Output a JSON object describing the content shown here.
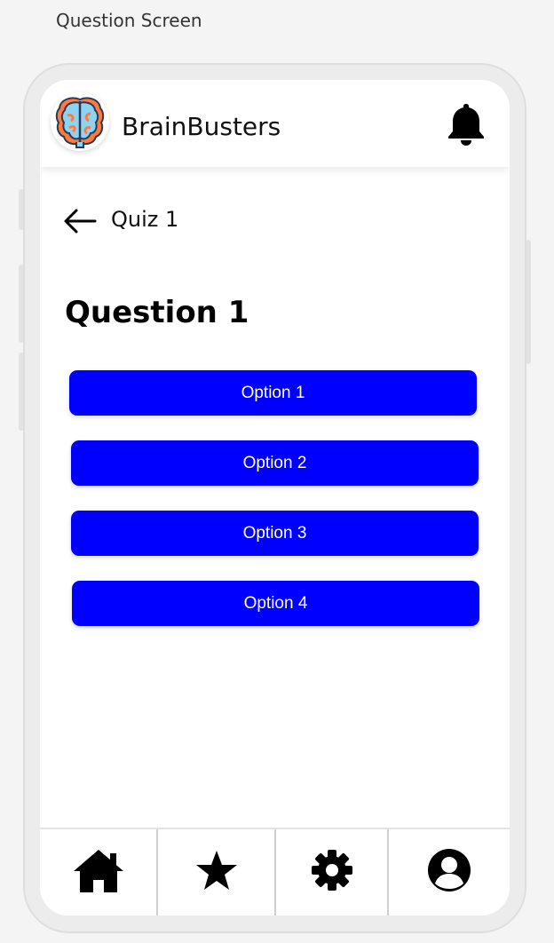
{
  "frame_title": "Question Screen",
  "header": {
    "app_name": "BrainBusters",
    "logo_icon": "brain-icon",
    "notification_icon": "bell-icon"
  },
  "quiz": {
    "back_icon": "arrow-left-icon",
    "title": "Quiz 1"
  },
  "question": {
    "title": "Question 1",
    "options": [
      "Option 1",
      "Option 2",
      "Option 3",
      "Option 4"
    ]
  },
  "nav": {
    "items": [
      "home-icon",
      "star-icon",
      "gear-icon",
      "user-icon"
    ]
  },
  "colors": {
    "accent": "#0000ff",
    "background": "#f4f4f4",
    "screen": "#ffffff"
  }
}
